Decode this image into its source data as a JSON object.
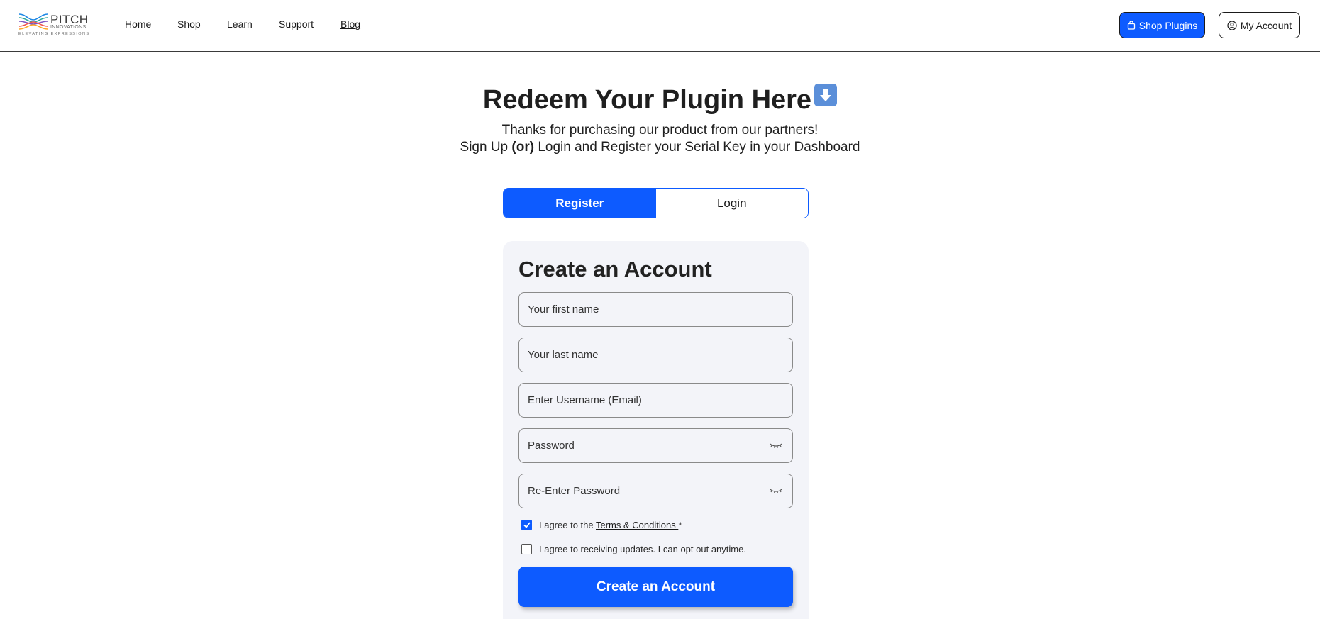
{
  "header": {
    "logo": {
      "word": "PITCH",
      "sub": "INNOVATIONS",
      "tagline": "ELEVATING EXPRESSIONS"
    },
    "nav": [
      {
        "label": "Home"
      },
      {
        "label": "Shop"
      },
      {
        "label": "Learn"
      },
      {
        "label": "Support"
      },
      {
        "label": "Blog"
      }
    ],
    "shop_plugins_label": "Shop Plugins",
    "my_account_label": "My Account"
  },
  "hero": {
    "title": "Redeem Your Plugin Here",
    "title_icon": "down-arrow-emoji-icon",
    "subtitle_line1": "Thanks for purchasing our product from our partners!",
    "subtitle_line2_pre": "Sign Up ",
    "subtitle_line2_bold": "(or)",
    "subtitle_line2_post": " Login and Register your Serial Key in your Dashboard"
  },
  "tabs": [
    {
      "label": "Register",
      "active": true
    },
    {
      "label": "Login",
      "active": false
    }
  ],
  "form": {
    "title": "Create an Account",
    "first_name_placeholder": "Your first name",
    "last_name_placeholder": "Your last name",
    "username_placeholder": "Enter Username (Email)",
    "password_placeholder": "Password",
    "reenter_password_placeholder": "Re-Enter Password",
    "terms_pre": "I agree to the ",
    "terms_link": "Terms & Conditions ",
    "terms_required": "*",
    "terms_checked": true,
    "updates_label": "I agree to receiving updates. I can opt out anytime.",
    "updates_checked": false,
    "submit_label": "Create an Account"
  },
  "colors": {
    "accent": "#0d5bff",
    "card_bg": "#f3f4f9",
    "text": "#1f1f1f"
  }
}
